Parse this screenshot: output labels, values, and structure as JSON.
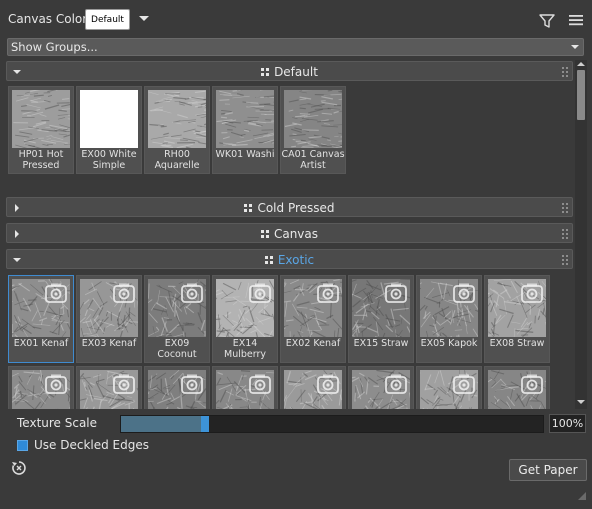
{
  "header": {
    "canvas_color_label": "Canvas Color",
    "swatch_label": "Default",
    "show_groups": "Show Groups..."
  },
  "groups": [
    {
      "title": "Default",
      "state": "expanded",
      "highlight": false
    },
    {
      "title": "Cold Pressed",
      "state": "collapsed",
      "highlight": false
    },
    {
      "title": "Canvas",
      "state": "collapsed",
      "highlight": false
    },
    {
      "title": "Exotic",
      "state": "expanded",
      "highlight": true
    }
  ],
  "default_papers": [
    {
      "line1": "HP01 Hot",
      "line2": "Pressed",
      "thumb": "#9d9d9d"
    },
    {
      "line1": "EX00 White",
      "line2": "Simple",
      "thumb": "#ffffff"
    },
    {
      "line1": "RH00",
      "line2": "Aquarelle",
      "thumb": "#a9a9a9"
    },
    {
      "line1": "WK01 Washi",
      "line2": "",
      "thumb": "#8f8f8f"
    },
    {
      "line1": "CA01 Canvas",
      "line2": "Artist",
      "thumb": "#858585"
    }
  ],
  "exotic_papers": [
    {
      "line1": "EX01 Kenaf",
      "line2": "",
      "thumb": "#8e8e8e",
      "selected": true
    },
    {
      "line1": "EX03 Kenaf",
      "line2": "",
      "thumb": "#979797",
      "selected": false
    },
    {
      "line1": "EX09",
      "line2": "Coconut",
      "thumb": "#7c7c7c",
      "selected": false
    },
    {
      "line1": "EX14",
      "line2": "Mulberry",
      "thumb": "#b3b3b3",
      "selected": false
    },
    {
      "line1": "EX02 Kenaf",
      "line2": "",
      "thumb": "#8a8a8a",
      "selected": false
    },
    {
      "line1": "EX15 Straw",
      "line2": "",
      "thumb": "#777777",
      "selected": false
    },
    {
      "line1": "EX05 Kapok",
      "line2": "",
      "thumb": "#868686",
      "selected": false
    },
    {
      "line1": "EX08 Straw",
      "line2": "",
      "thumb": "#a2a2a2",
      "selected": false
    }
  ],
  "exotic_row2_thumbs": [
    "#8c8c8c",
    "#999999",
    "#7f7f7f",
    "#888888",
    "#9a9a9a",
    "#8d8d8d",
    "#a0a0a0",
    "#868686"
  ],
  "texture_scale": {
    "label": "Texture Scale",
    "value_text": "100%",
    "fill_fraction": 0.2
  },
  "deckled_edges": {
    "label": "Use Deckled Edges",
    "checked": true
  },
  "get_paper_label": "Get Paper",
  "icons": {
    "dropdown": "chevron-down-icon",
    "filter": "filter-icon",
    "menu": "hamburger-menu-icon",
    "camera": "camera-icon",
    "reset": "reset-icon",
    "grip": "grip-icon"
  },
  "colors": {
    "accent": "#3d93d8",
    "highlight_text": "#5aa6e6",
    "panel_bg": "#3a3a3a"
  }
}
